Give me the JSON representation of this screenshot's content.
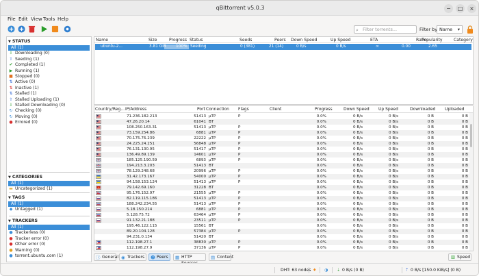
{
  "app": {
    "title": "qBittorrent v5.0.3",
    "minimize": "−",
    "maximize": "□",
    "close": "×"
  },
  "menu": [
    "File",
    "Edit",
    "View",
    "Tools",
    "Help"
  ],
  "search": {
    "placeholder": "Filter torrents..."
  },
  "filter": {
    "label": "Filter by:",
    "value": "Name"
  },
  "colors": {
    "accent": "#3b8ed8",
    "seed_progress": "#3b8ed8"
  },
  "sidebar": {
    "status": {
      "title": "STATUS",
      "items": [
        {
          "label": "All (1)",
          "icon": "all-icon",
          "color": "#3b8ed8"
        },
        {
          "label": "Downloading (0)",
          "icon": "download-arrow-icon",
          "color": "#2a9d2a"
        },
        {
          "label": "Seeding (1)",
          "icon": "upload-arrow-icon",
          "color": "#3b6fd8"
        },
        {
          "label": "Completed (1)",
          "icon": "checkmark-icon",
          "color": "#2a9d2a"
        },
        {
          "label": "Running (1)",
          "icon": "play-icon",
          "color": "#2a9d2a"
        },
        {
          "label": "Stopped (0)",
          "icon": "stop-icon",
          "color": "#e07020"
        },
        {
          "label": "Active (0)",
          "icon": "active-arrows-icon",
          "color": "#3b6fd8"
        },
        {
          "label": "Inactive (1)",
          "icon": "inactive-arrows-icon",
          "color": "#d83030"
        },
        {
          "label": "Stalled (1)",
          "icon": "stalled-icon",
          "color": "#3b6fd8"
        },
        {
          "label": "Stalled Uploading (1)",
          "icon": "stalled-up-icon",
          "color": "#3b6fd8"
        },
        {
          "label": "Stalled Downloading (0)",
          "icon": "stalled-down-icon",
          "color": "#2a9d2a"
        },
        {
          "label": "Checking (0)",
          "icon": "checking-icon",
          "color": "#3b8ed8"
        },
        {
          "label": "Moving (0)",
          "icon": "moving-icon",
          "color": "#3b8ed8"
        },
        {
          "label": "Errored (0)",
          "icon": "error-icon",
          "color": "#d83030"
        }
      ]
    },
    "categories": {
      "title": "CATEGORIES",
      "items": [
        {
          "label": "All (1)",
          "icon": "folder-icon"
        },
        {
          "label": "Uncategorized (1)",
          "icon": "folder-icon"
        }
      ]
    },
    "tags": {
      "title": "TAGS",
      "items": [
        {
          "label": "All (1)",
          "icon": "tag-icon"
        },
        {
          "label": "Untagged (1)",
          "icon": "tag-icon"
        }
      ]
    },
    "trackers": {
      "title": "TRACKERS",
      "items": [
        {
          "label": "All (1)",
          "icon": "tracker-icon"
        },
        {
          "label": "Trackerless (0)",
          "icon": "tracker-icon"
        },
        {
          "label": "Tracker error (0)",
          "icon": "tracker-error-icon"
        },
        {
          "label": "Other error (0)",
          "icon": "tracker-error-icon"
        },
        {
          "label": "Warning (0)",
          "icon": "warning-icon"
        },
        {
          "label": "torrent.ubuntu.com (1)",
          "icon": "tracker-icon"
        }
      ]
    }
  },
  "torrent_table": {
    "headers": [
      "Name",
      "Size",
      "Progress",
      "Status",
      "Seeds",
      "Peers",
      "Down Speed",
      "Up Speed",
      "ETA",
      "Ratio",
      "Popularity",
      "Category"
    ],
    "rows": [
      {
        "name": "ubuntu-2...",
        "size": "3.81 GiB",
        "progress": "100%",
        "progress_value": 1.0,
        "status": "Seeding",
        "seeds": "0 (381)",
        "peers": "21 (14)",
        "down": "0 B/s",
        "up": "0 B/s",
        "eta": "∞",
        "ratio": "0.00",
        "popularity": "2.65",
        "category": ""
      }
    ]
  },
  "peers_table": {
    "headers": [
      "Country/Reg...",
      "IP/Address",
      "Port",
      "Connection",
      "Flags",
      "Client",
      "Progress",
      "Down Speed",
      "Up Speed",
      "Downloaded",
      "Uploaded"
    ],
    "rows": [
      {
        "flag": "us",
        "ip": "71.236.182.213",
        "port": "51413",
        "conn": "μTP",
        "flags": "P",
        "progress": "0.0%",
        "down": "0 B/s",
        "up": "0 B/s",
        "dl": "0 B",
        "ul": "0 B"
      },
      {
        "flag": "us",
        "ip": "47.26.20.14",
        "port": "61041",
        "conn": "BT",
        "flags": "",
        "progress": "0.0%",
        "down": "0 B/s",
        "up": "0 B/s",
        "dl": "0 B",
        "ul": "0 B"
      },
      {
        "flag": "us",
        "ip": "108.250.163.31",
        "port": "51413",
        "conn": "μTP",
        "flags": "P",
        "progress": "0.0%",
        "down": "0 B/s",
        "up": "0 B/s",
        "dl": "0 B",
        "ul": "0 B"
      },
      {
        "flag": "us",
        "ip": "73.159.254.86",
        "port": "6881",
        "conn": "μTP",
        "flags": "P",
        "progress": "0.0%",
        "down": "0 B/s",
        "up": "0 B/s",
        "dl": "0 B",
        "ul": "0 B"
      },
      {
        "flag": "us",
        "ip": "70.175.76.239",
        "port": "22222",
        "conn": "μTP",
        "flags": "P",
        "progress": "0.0%",
        "down": "0 B/s",
        "up": "0 B/s",
        "dl": "0 B",
        "ul": "0 B"
      },
      {
        "flag": "us",
        "ip": "24.225.24.251",
        "port": "56848",
        "conn": "μTP",
        "flags": "P",
        "progress": "0.0%",
        "down": "0 B/s",
        "up": "0 B/s",
        "dl": "0 B",
        "ul": "0 B"
      },
      {
        "flag": "us",
        "ip": "76.131.130.95",
        "port": "51417",
        "conn": "μTP",
        "flags": "P",
        "progress": "0.0%",
        "down": "0 B/s",
        "up": "0 B/s",
        "dl": "0 B",
        "ul": "0 B"
      },
      {
        "flag": "us",
        "ip": "136.49.89.139",
        "port": "14601",
        "conn": "μTP",
        "flags": "P",
        "progress": "0.0%",
        "down": "0 B/s",
        "up": "0 B/s",
        "dl": "0 B",
        "ul": "0 B"
      },
      {
        "flag": "gb",
        "ip": "185.125.190.59",
        "port": "6893",
        "conn": "μTP",
        "flags": "P",
        "progress": "0.0%",
        "down": "0 B/s",
        "up": "0 B/s",
        "dl": "0 B",
        "ul": "0 B"
      },
      {
        "flag": "gb",
        "ip": "194.213.3.203",
        "port": "51413",
        "conn": "BT",
        "flags": "",
        "progress": "0.0%",
        "down": "0 B/s",
        "up": "0 B/s",
        "dl": "0 B",
        "ul": "0 B"
      },
      {
        "flag": "gb",
        "ip": "78.129.248.68",
        "port": "20996",
        "conn": "μTP",
        "flags": "P",
        "progress": "0.0%",
        "down": "0 B/s",
        "up": "0 B/s",
        "dl": "0 B",
        "ul": "0 B"
      },
      {
        "flag": "ua",
        "ip": "31.42.173.167",
        "port": "54000",
        "conn": "μTP",
        "flags": "P",
        "progress": "0.0%",
        "down": "0 B/s",
        "up": "0 B/s",
        "dl": "0 B",
        "ul": "0 B"
      },
      {
        "flag": "ua",
        "ip": "94.158.153.124",
        "port": "51413",
        "conn": "μTP",
        "flags": "P",
        "progress": "0.0%",
        "down": "0 B/s",
        "up": "0 B/s",
        "dl": "0 B",
        "ul": "0 B"
      },
      {
        "flag": "vn",
        "ip": "79.142.69.160",
        "port": "31228",
        "conn": "BT",
        "flags": "",
        "progress": "0.0%",
        "down": "0 B/s",
        "up": "0 B/s",
        "dl": "0 B",
        "ul": "0 B"
      },
      {
        "flag": "sk",
        "ip": "95.176.152.97",
        "port": "21555",
        "conn": "μTP",
        "flags": "P",
        "progress": "0.0%",
        "down": "0 B/s",
        "up": "0 B/s",
        "dl": "0 B",
        "ul": "0 B"
      },
      {
        "flag": "ru",
        "ip": "82.119.115.186",
        "port": "51413",
        "conn": "μTP",
        "flags": "P",
        "progress": "0.0%",
        "down": "0 B/s",
        "up": "0 B/s",
        "dl": "0 B",
        "ul": "0 B"
      },
      {
        "flag": "ru",
        "ip": "188.242.234.55",
        "port": "51413",
        "conn": "μTP",
        "flags": "P",
        "progress": "0.0%",
        "down": "0 B/s",
        "up": "0 B/s",
        "dl": "0 B",
        "ul": "0 B"
      },
      {
        "flag": "ru",
        "ip": "5.18.150.214",
        "port": "6881",
        "conn": "μTP",
        "flags": "P",
        "progress": "0.0%",
        "down": "0 B/s",
        "up": "0 B/s",
        "dl": "0 B",
        "ul": "0 B"
      },
      {
        "flag": "ru",
        "ip": "5.128.75.72",
        "port": "63464",
        "conn": "μTP",
        "flags": "P",
        "progress": "0.0%",
        "down": "0 B/s",
        "up": "0 B/s",
        "dl": "0 B",
        "ul": "0 B"
      },
      {
        "flag": "ru",
        "ip": "91.132.21.188",
        "port": "23511",
        "conn": "μTP",
        "flags": "P",
        "progress": "0.0%",
        "down": "0 B/s",
        "up": "0 B/s",
        "dl": "0 B",
        "ul": "0 B"
      },
      {
        "flag": "",
        "ip": "195.46.122.115",
        "port": "15561",
        "conn": "BT",
        "flags": "",
        "progress": "0.0%",
        "down": "0 B/s",
        "up": "0 B/s",
        "dl": "0 B",
        "ul": "0 B"
      },
      {
        "flag": "",
        "ip": "89.20.104.128",
        "port": "57384",
        "conn": "μTP",
        "flags": "P",
        "progress": "0.0%",
        "down": "0 B/s",
        "up": "0 B/s",
        "dl": "0 B",
        "ul": "0 B"
      },
      {
        "flag": "",
        "ip": "94.231.0.134",
        "port": "51420",
        "conn": "BT",
        "flags": "",
        "progress": "0.0%",
        "down": "0 B/s",
        "up": "0 B/s",
        "dl": "0 B",
        "ul": "0 B"
      },
      {
        "flag": "ph",
        "ip": "112.198.27.1",
        "port": "38830",
        "conn": "μTP",
        "flags": "P",
        "progress": "0.0%",
        "down": "0 B/s",
        "up": "0 B/s",
        "dl": "0 B",
        "ul": "0 B"
      },
      {
        "flag": "ph",
        "ip": "112.198.27.9",
        "port": "37136",
        "conn": "μTP",
        "flags": "P",
        "progress": "0.0%",
        "down": "0 B/s",
        "up": "0 B/s",
        "dl": "0 B",
        "ul": "0 B"
      }
    ]
  },
  "tabs": [
    {
      "label": "General",
      "icon": "info-icon"
    },
    {
      "label": "Trackers",
      "icon": "tracker-icon"
    },
    {
      "label": "Peers",
      "icon": "peers-icon"
    },
    {
      "label": "HTTP Sources",
      "icon": "http-icon"
    },
    {
      "label": "Content",
      "icon": "content-icon"
    }
  ],
  "speed_button": "Speed",
  "statusbar": {
    "dht": "DHT: 63 nodes",
    "down": "0 B/s (0 B)",
    "up": "0 B/s [150.0 KiB/s] (0 B)"
  }
}
